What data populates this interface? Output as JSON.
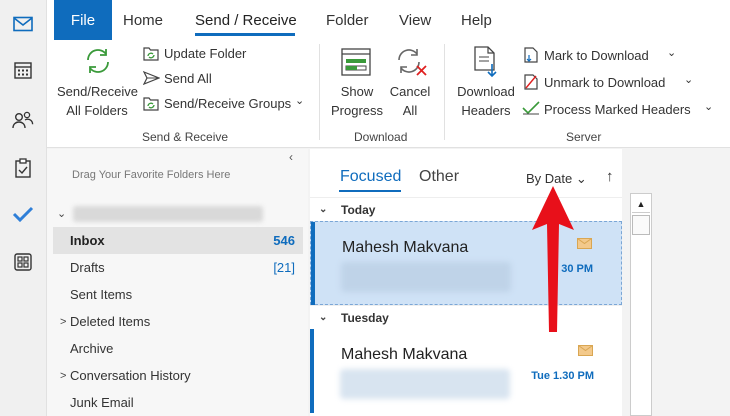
{
  "ribbon_tabs": {
    "file": "File",
    "home": "Home",
    "send_receive": "Send / Receive",
    "folder": "Folder",
    "view": "View",
    "help": "Help"
  },
  "ribbon": {
    "send_receive_all_line1": "Send/Receive",
    "send_receive_all_line2": "All Folders",
    "update_folder": "Update Folder",
    "send_all": "Send All",
    "send_receive_groups": "Send/Receive Groups",
    "group_send_receive": "Send & Receive",
    "show_progress_line1": "Show",
    "show_progress_line2": "Progress",
    "cancel_all_line1": "Cancel",
    "cancel_all_line2": "All",
    "group_download": "Download",
    "download_headers_line1": "Download",
    "download_headers_line2": "Headers",
    "mark_to_download": "Mark to Download",
    "unmark_to_download": "Unmark to Download",
    "process_marked_headers": "Process Marked Headers",
    "group_server": "Server",
    "dropdown_glyph": "⌄"
  },
  "folder_pane": {
    "favorites_hint": "Drag Your Favorite Folders Here",
    "collapse_glyph": "‹",
    "account_chevron": "⌄",
    "folders": [
      {
        "name": "Inbox",
        "count": "546"
      },
      {
        "name": "Drafts",
        "count": "[21]"
      },
      {
        "name": "Sent Items",
        "count": ""
      },
      {
        "name": "Deleted Items",
        "count": ""
      },
      {
        "name": "Archive",
        "count": ""
      },
      {
        "name": "Conversation History",
        "count": ""
      },
      {
        "name": "Junk Email",
        "count": ""
      }
    ],
    "expand_glyph": ">"
  },
  "message_list": {
    "tab_focused": "Focused",
    "tab_other": "Other",
    "sort_label": "By Date",
    "sort_chevron": "⌄",
    "sort_direction": "↑",
    "groups": [
      {
        "label": "Today",
        "chevron": "⌄"
      },
      {
        "label": "Tuesday",
        "chevron": "⌄"
      }
    ],
    "messages": [
      {
        "from": "Mahesh Makvana",
        "time": "1:30 PM",
        "time_visible": "30 PM",
        "selected": true
      },
      {
        "from": "Mahesh Makvana",
        "time": "Tue 1.30 PM",
        "selected": false
      }
    ]
  },
  "scrollbar": {
    "up_glyph": "▲"
  },
  "colors": {
    "accent": "#0f6cbd",
    "annotation_arrow": "#e8101a",
    "selected_row": "#cfe2f6"
  }
}
